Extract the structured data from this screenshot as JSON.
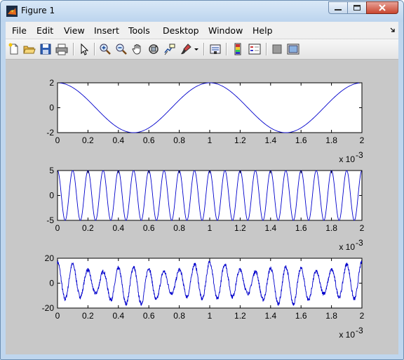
{
  "window": {
    "title": "Figure 1",
    "app_icon": "matlab-icon",
    "controls": [
      "minimize-icon",
      "maximize-icon",
      "close-icon"
    ]
  },
  "menu": [
    "File",
    "Edit",
    "View",
    "Insert",
    "Tools",
    "Desktop",
    "Window",
    "Help"
  ],
  "toolbar": [
    "new-figure-icon",
    "open-file-icon",
    "save-icon",
    "print-icon",
    "pointer-icon",
    "zoom-in-icon",
    "zoom-out-icon",
    "pan-hand-icon",
    "rotate-3d-icon",
    "data-cursor-icon",
    "brush-icon",
    "brush-dropdown-icon",
    "link-plot-icon",
    "colorbar-icon",
    "legend-icon",
    "hide-plot-tools-icon",
    "show-plot-tools-icon"
  ],
  "colors": {
    "line": "#0000cc",
    "canvas": "#c8c8c8",
    "axes_bg": "#ffffff"
  },
  "chart_data": [
    {
      "type": "line",
      "title": "",
      "xlabel": "",
      "ylabel": "",
      "xlim": [
        0,
        0.002
      ],
      "ylim": [
        -2,
        2
      ],
      "x_ticks": [
        "0",
        "0.2",
        "0.4",
        "0.6",
        "0.8",
        "1",
        "1.2",
        "1.4",
        "1.6",
        "1.8",
        "2"
      ],
      "y_ticks": [
        "-2",
        "0",
        "2"
      ],
      "x_multiplier": "x 10",
      "x_exponent": "-3",
      "grid": false,
      "series": [
        {
          "x": [
            0,
            0.0001,
            0.0002,
            0.0003,
            0.0004,
            0.0005,
            0.0006,
            0.0007,
            0.0008,
            0.0009,
            0.001,
            0.0011,
            0.0012,
            0.0013,
            0.0014,
            0.0015,
            0.0016,
            0.0017,
            0.0018,
            0.0019,
            0.002
          ],
          "y": [
            2,
            1.9,
            1.62,
            1.18,
            0.62,
            0,
            -0.62,
            -1.18,
            -1.62,
            -1.9,
            -2,
            -1.9,
            -1.62,
            -1.18,
            -0.62,
            0,
            0.62,
            1.18,
            1.62,
            1.9,
            2
          ]
        }
      ]
    },
    {
      "type": "line",
      "title": "",
      "xlabel": "",
      "ylabel": "",
      "xlim": [
        0,
        0.002
      ],
      "ylim": [
        -5,
        5
      ],
      "x_ticks": [
        "0",
        "0.2",
        "0.4",
        "0.6",
        "0.8",
        "1",
        "1.2",
        "1.4",
        "1.6",
        "1.8",
        "2"
      ],
      "y_ticks": [
        "-5",
        "0",
        "5"
      ],
      "x_multiplier": "x 10",
      "x_exponent": "-3",
      "grid": false,
      "series": [
        {
          "x": [
            0,
            5e-05,
            0.0001,
            0.00015,
            0.0002,
            0.00025,
            0.0003,
            0.00035,
            0.0004,
            0.00045,
            0.0005,
            0.00055,
            0.0006,
            0.00065,
            0.0007,
            0.00075,
            0.0008,
            0.00085,
            0.0009,
            0.00095,
            0.001,
            0.00105,
            0.0011,
            0.00115,
            0.0012,
            0.00125,
            0.0013,
            0.00135,
            0.0014,
            0.00145,
            0.0015,
            0.00155,
            0.0016,
            0.00165,
            0.0017,
            0.00175,
            0.0018,
            0.00185,
            0.0019,
            0.00195,
            0.002
          ],
          "y": [
            5,
            -5,
            5,
            -5,
            5,
            -5,
            5,
            -5,
            5,
            -5,
            5,
            -5,
            5,
            -5,
            5,
            -5,
            5,
            -5,
            5,
            -5,
            5,
            -5,
            5,
            -5,
            5,
            -5,
            5,
            -5,
            5,
            -5,
            5,
            -5,
            5,
            -5,
            5,
            -5,
            5,
            -5,
            5,
            -5,
            5
          ]
        }
      ]
    },
    {
      "type": "line",
      "title": "",
      "xlabel": "",
      "ylabel": "",
      "xlim": [
        0,
        0.002
      ],
      "ylim": [
        -20,
        20
      ],
      "x_ticks": [
        "0",
        "0.2",
        "0.4",
        "0.6",
        "0.8",
        "1",
        "1.2",
        "1.4",
        "1.6",
        "1.8",
        "2"
      ],
      "y_ticks": [
        "-20",
        "0",
        "20"
      ],
      "x_multiplier": "x 10",
      "x_exponent": "-3",
      "grid": false,
      "series": [
        {
          "x": [
            0,
            5e-05,
            0.0001,
            0.00015,
            0.0002,
            0.00025,
            0.0003,
            0.00035,
            0.0004,
            0.00045,
            0.0005,
            0.00055,
            0.0006,
            0.00065,
            0.0007,
            0.00075,
            0.0008,
            0.00085,
            0.0009,
            0.00095,
            0.001,
            0.00105,
            0.0011,
            0.00115,
            0.0012,
            0.00125,
            0.0013,
            0.00135,
            0.0014,
            0.00145,
            0.0015,
            0.00155,
            0.0016,
            0.00165,
            0.0017,
            0.00175,
            0.0018,
            0.00185,
            0.0019,
            0.00195,
            0.002
          ],
          "y": [
            16,
            -14,
            15,
            -11,
            11,
            -7,
            8,
            -4,
            4,
            0,
            0,
            2,
            -4,
            7,
            -9,
            10,
            -12,
            12,
            -13,
            14,
            -14,
            13,
            -13,
            12,
            -11,
            9,
            -9,
            6,
            -4,
            2,
            0,
            3,
            -4,
            7,
            -9,
            11,
            -12,
            13,
            -14,
            15,
            -16
          ]
        }
      ]
    }
  ]
}
